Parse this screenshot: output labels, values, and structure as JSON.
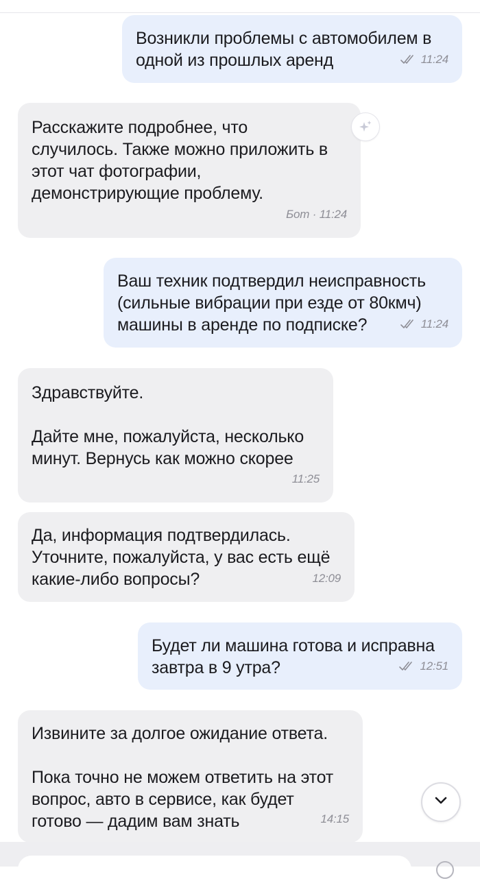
{
  "messages": [
    {
      "direction": "outgoing",
      "text": "Возникли проблемы с автомобилем в\nодной из прошлых аренд",
      "time": "11:24",
      "read_receipt": "double-check-icon"
    },
    {
      "direction": "incoming",
      "text": "Расскажите подробнее, что\nслучилось. Также можно приложить в\nэтот чат фотографии,\nдемонстрирующие проблему.",
      "time": "Бот · 11:24",
      "badge_icon": "ai-sparkle-icon"
    },
    {
      "direction": "outgoing",
      "text": "Ваш техник подтвердил неисправность\n(сильные вибрации при езде от 80кмч)\nмашины в аренде по подписке?",
      "time": "11:24",
      "read_receipt": "double-check-icon"
    },
    {
      "direction": "incoming",
      "text": "Здравствуйте.\n\nДайте мне, пожалуйста, несколько\nминут. Вернусь как можно скорее",
      "time": "11:25"
    },
    {
      "direction": "incoming",
      "text": "Да, информация подтвердилась.\nУточните, пожалуйста, у вас есть ещё\nкакие-либо вопросы?",
      "time": "12:09"
    },
    {
      "direction": "outgoing",
      "text": "Будет ли машина готова и исправна\nзавтра в 9 утра?",
      "time": "12:51",
      "read_receipt": "double-check-icon"
    },
    {
      "direction": "incoming",
      "text": "Извините за долгое ожидание ответа.\n\nПока точно не можем ответить на этот\nвопрос, авто в сервисе, как будет\nготово — дадим вам знать",
      "time": "14:15"
    }
  ],
  "controls": {
    "scroll_down_icon": "chevron-down-icon"
  },
  "colors": {
    "outgoing_bubble": "#e8effc",
    "incoming_bubble": "#efeff1",
    "meta_text": "#8e8e96",
    "background": "#ffffff"
  }
}
